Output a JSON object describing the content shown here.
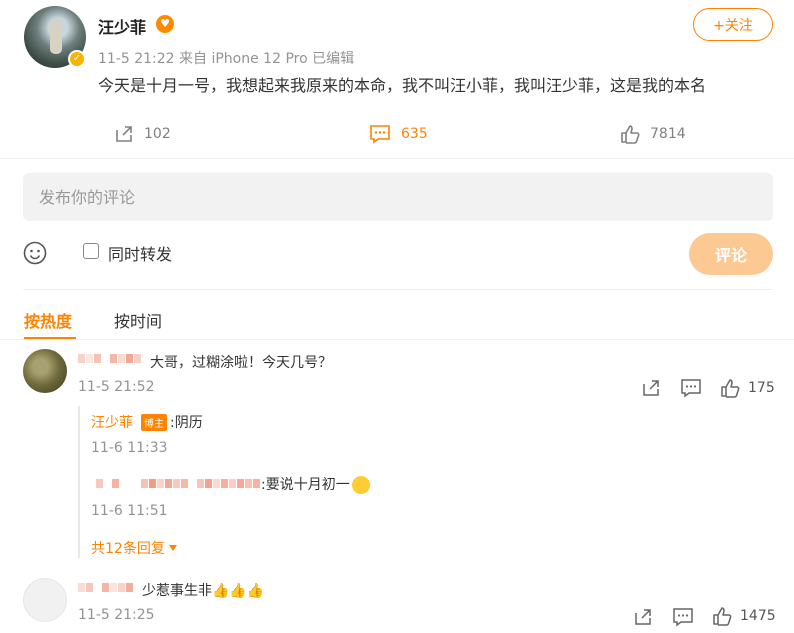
{
  "post": {
    "author": "汪少菲",
    "meta": "11-5 21:22  来自 iPhone 12 Pro  已编辑",
    "text": "今天是十月一号，我想起来我原来的本命，我不叫汪小菲，我叫汪少菲，这是我的本名",
    "follow_label": "+关注",
    "reposts": "102",
    "comments": "635",
    "likes": "7814"
  },
  "composer": {
    "placeholder": "发布你的评论",
    "repost_label": "同时转发",
    "submit_label": "评论"
  },
  "sort_tabs": {
    "hot": "按热度",
    "time": "按时间"
  },
  "comments": [
    {
      "text": "大哥，过糊涂啦！今天几号？",
      "time": "11-5 21:52",
      "likes": "175",
      "replies": [
        {
          "author": "汪少菲",
          "badge": "博主",
          "text": ":阴历",
          "time": "11-6 11:33"
        },
        {
          "text": ":要说十月初一",
          "time": "11-6 11:51"
        }
      ],
      "more_replies": "共12条回复"
    },
    {
      "text": "少惹事生非👍👍👍",
      "time": "11-5 21:25",
      "likes": "1475"
    }
  ],
  "colors": {
    "accent": "#ff8200",
    "submit_disabled": "#fdc993"
  },
  "icons": [
    "share-icon",
    "comment-icon",
    "like-icon",
    "emoji-icon",
    "caret-down-icon"
  ]
}
